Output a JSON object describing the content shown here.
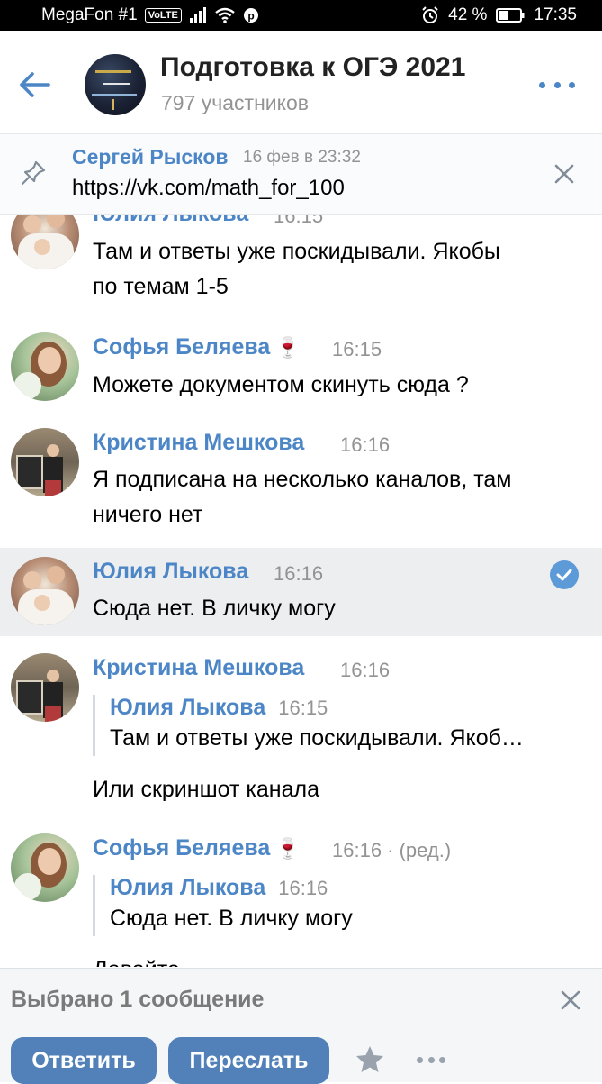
{
  "status_bar": {
    "carrier": "MegaFon #1",
    "volte": "VoLTE",
    "battery": "42 %",
    "time": "17:35"
  },
  "header": {
    "title": "Подготовка к ОГЭ 2021",
    "members": "797 участников"
  },
  "pinned": {
    "author": "Сергей Рысков",
    "time": "16 фев в 23:32",
    "text": "https://vk.com/math_for_100"
  },
  "messages": [
    {
      "author": "Юлия Лыкова",
      "time": "16:15",
      "lines": [
        "Там и ответы уже поскидывали. Якобы",
        "по темам 1-5"
      ]
    },
    {
      "author": "Софья Беляева",
      "emoji": "🍷",
      "time": "16:15",
      "lines": [
        "Можете документом скинуть сюда ?"
      ]
    },
    {
      "author": "Кристина Мешкова",
      "time": "16:16",
      "lines": [
        "Я подписана на несколько каналов, там",
        "ничего нет"
      ]
    },
    {
      "author": "Юлия Лыкова",
      "time": "16:16",
      "lines": [
        "Сюда нет. В личку могу"
      ],
      "selected": true
    },
    {
      "author": "Кристина Мешкова",
      "time": "16:16",
      "quote": {
        "author": "Юлия Лыкова",
        "time": "16:15",
        "text": "Там и ответы уже поскидывали. Якоб…"
      },
      "lines": [
        "Или скриншот канала"
      ]
    },
    {
      "author": "Софья Беляева",
      "emoji": "🍷",
      "time": "16:16 · (ред.)",
      "quote": {
        "author": "Юлия Лыкова",
        "time": "16:16",
        "text": "Сюда нет. В личку могу"
      },
      "lines": [
        "Давайте"
      ]
    }
  ],
  "selection_bar": {
    "count_label": "Выбрано 1 сообщение",
    "reply_label": "Ответить",
    "forward_label": "Переслать"
  },
  "colors": {
    "accent": "#4c86c6",
    "button": "#5181b8",
    "selected_bg": "#edeef0",
    "muted": "#939393"
  }
}
